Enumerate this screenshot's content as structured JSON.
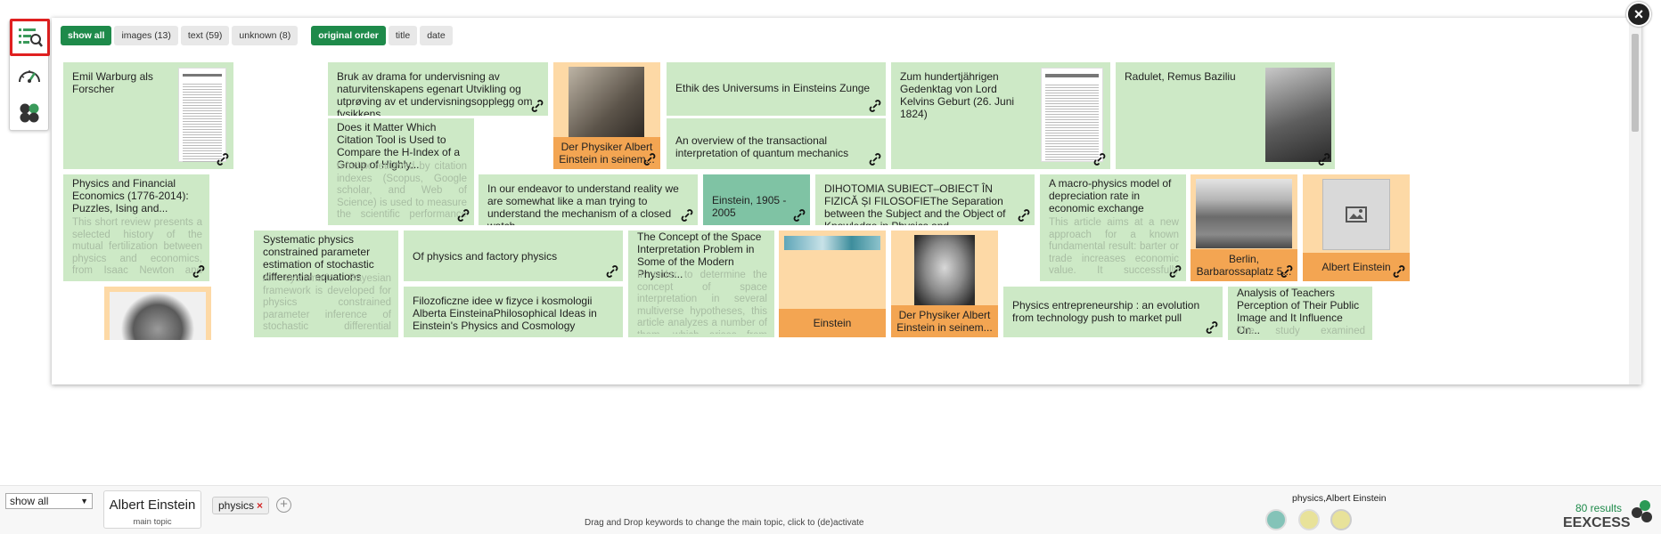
{
  "toolbar": {
    "rail_buttons": [
      "search-result-list-icon",
      "dashboard-gauge-icon",
      "hexagon-cluster-icon"
    ],
    "filters": {
      "show_all": "show all",
      "images": "images (13)",
      "text": "text (59)",
      "unknown": "unknown (8)",
      "original_order": "original order",
      "title": "title",
      "date": "date"
    },
    "close": "×"
  },
  "tiles": [
    {
      "title": "Emil Warburg als Forscher",
      "type": "text-image"
    },
    {
      "title": "Bruk av drama for undervisning av naturvitenskapens egenart Utvikling og utprøving av et undervisningsopplegg om fysikkens...",
      "type": "text"
    },
    {
      "caption": "Der Physiker Albert Einstein in seinem...",
      "type": "image"
    },
    {
      "title": "Ethik des Universums in Einsteins Zunge",
      "type": "text"
    },
    {
      "title": "Zum hundertjährigen Gedenktag von Lord Kelvins Geburt (26. Juni 1824)",
      "type": "text-image"
    },
    {
      "title": "Radulet, Remus Baziliu",
      "type": "text-image"
    },
    {
      "title": "Does it Matter Which Citation Tool is Used to Compare the H-Index of a Group of Highly...",
      "desc": "h-index retrieved by citation indexes (Scopus, Google scholar, and Web of Science) is used to measure the scientific performance and the research impact studies based on the...",
      "type": "text"
    },
    {
      "title": "An overview of the transactional interpretation of quantum mechanics",
      "type": "text"
    },
    {
      "title": "Physics and Financial Economics (1776-2014): Puzzles, Ising and...",
      "desc": "This short review presents a selected history of the mutual fertilization between physics and economics, from Isaac Newton and Adam Smith to the present. The fundamentally...",
      "type": "text"
    },
    {
      "title": "In our endeavor to understand reality we are somewhat like a man trying to understand the mechanism of a closed watch...",
      "type": "text"
    },
    {
      "title": "Einstein, 1905 - 2005",
      "type": "text"
    },
    {
      "title": "DIHOTOMIA SUBIECT–OBIECT ÎN FIZICĂ ȘI FILOSOFIEThe Separation between the Subject and the Object of Knowledge in Physics and...",
      "type": "text"
    },
    {
      "title": "A macro-physics model of depreciation rate in economic exchange",
      "desc": "This article aims at a new approach for a known fundamental result: barter or trade increases economic value. It successfully bridges the gap between the theory of...",
      "type": "text"
    },
    {
      "caption": "Berlin, Barbarossaplatz 5...",
      "type": "image"
    },
    {
      "caption": "Albert Einstein",
      "type": "image-placeholder"
    },
    {
      "title": "Systematic physics constrained parameter estimation of stochastic differential equations",
      "desc": "A systematic Bayesian framework is developed for physics constrained parameter inference of stochastic differential equations (SDE) from partial observations...",
      "type": "text"
    },
    {
      "title": "Of physics and factory physics",
      "type": "text"
    },
    {
      "title": "The Concept of the Space Interpretation Problem in Some of the Modern Physics...",
      "desc": "In order to determine the concept of space interpretation in several multiverse hypotheses, this article analyzes a number of them, which arises from some...",
      "type": "text"
    },
    {
      "caption": "Einstein",
      "type": "image"
    },
    {
      "caption": "Der Physiker Albert Einstein in seinem...",
      "type": "image"
    },
    {
      "title": "Filozoficzne idee w fizyce i kosmologii Alberta EinsteinaPhilosophical Ideas in Einstein's Physics and Cosmology",
      "type": "text"
    },
    {
      "title": "Physics entrepreneurship : an evolution from technology push to market pull",
      "type": "text"
    },
    {
      "title": "Analysis of Teachers Perception of Their Public Image and It Influence On...",
      "desc": "The study examined teachers'",
      "type": "text"
    }
  ],
  "bottom": {
    "select_value": "show all",
    "main_topic": "Albert Einstein",
    "main_topic_sub": "main topic",
    "keyword": "physics",
    "keyword_remove": "×",
    "add": "+",
    "hint": "Drag and Drop keywords to change the main topic, click to (de)activate",
    "history_label": "physics,Albert Einstein",
    "results": "80 results",
    "brand": "EEXCESS"
  },
  "colors": {
    "accent": "#1e8a4a",
    "tile_text": "#cde9c6",
    "tile_image": "#fdd9a6",
    "caption": "#f3a552",
    "highlight": "#e02020"
  }
}
